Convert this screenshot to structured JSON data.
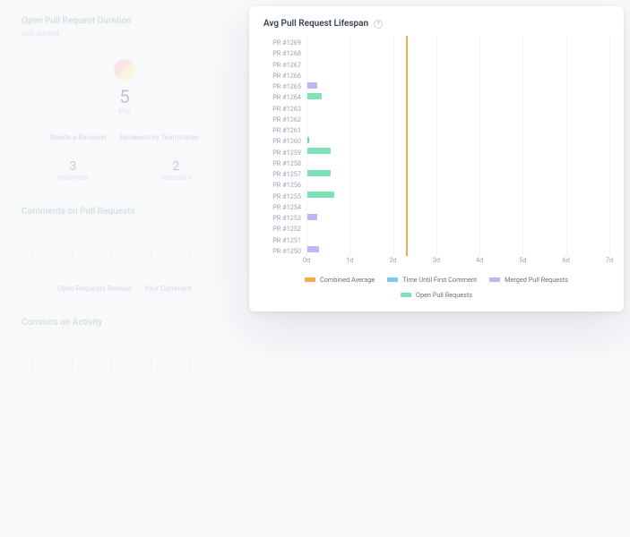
{
  "background": {
    "section1_title": "Open Pull Request Duration",
    "section1_sub": "only current",
    "big_stat_num": "5",
    "big_stat_lbl": "PRs",
    "legend_a": "Needs a Reviewer",
    "legend_b": "Reviewed by Teammates",
    "col1_num": "3",
    "col1_lbl": "reviewers",
    "col2_num": "2",
    "col2_lbl": "reviewers",
    "section2_title": "Comments on Pull Requests",
    "section2_legend_a": "Open Requests Remain",
    "section2_legend_b": "Your Comment",
    "section3_title": "Commits on Activity"
  },
  "modal": {
    "title": "Avg Pull Request Lifespan"
  },
  "chart_data": {
    "type": "bar",
    "orientation": "horizontal",
    "xlabel": "",
    "ylabel": "",
    "xlim": [
      0,
      7
    ],
    "x_ticks": [
      "0d",
      "1d",
      "2d",
      "3d",
      "4d",
      "5d",
      "6d",
      "7d"
    ],
    "combined_average": 2.3,
    "categories": [
      "PR #1269",
      "PR #1268",
      "PR #1267",
      "PR #1266",
      "PR #1265",
      "PR #1264",
      "PR #1263",
      "PR #1262",
      "PR #1261",
      "PR #1260",
      "PR #1259",
      "PR #1258",
      "PR #1257",
      "PR #1256",
      "PR #1255",
      "PR #1254",
      "PR #1253",
      "PR #1252",
      "PR #1251",
      "PR #1250"
    ],
    "series": [
      {
        "name": "Time Until First Comment",
        "color": "blue",
        "values": [
          0,
          0,
          0,
          0,
          0,
          0,
          0,
          0,
          0,
          0.06,
          0,
          0,
          0,
          0,
          0,
          0,
          0,
          0,
          0,
          0
        ]
      },
      {
        "name": "Merged Pull Requests",
        "color": "purple",
        "values": [
          0,
          0,
          0,
          0,
          0.25,
          0,
          0,
          0,
          0,
          0,
          0,
          0,
          0,
          0,
          0,
          0,
          0.25,
          0,
          0,
          0.3
        ]
      },
      {
        "name": "Open Pull Requests",
        "color": "green",
        "values": [
          0,
          0,
          0,
          0,
          0,
          0.35,
          0,
          0,
          0,
          0,
          0.55,
          0,
          0.55,
          0,
          0.65,
          0,
          0,
          0,
          0,
          0
        ]
      }
    ],
    "legend": [
      "Combined Average",
      "Time Until First Comment",
      "Merged Pull Requests",
      "Open Pull Requests"
    ]
  }
}
